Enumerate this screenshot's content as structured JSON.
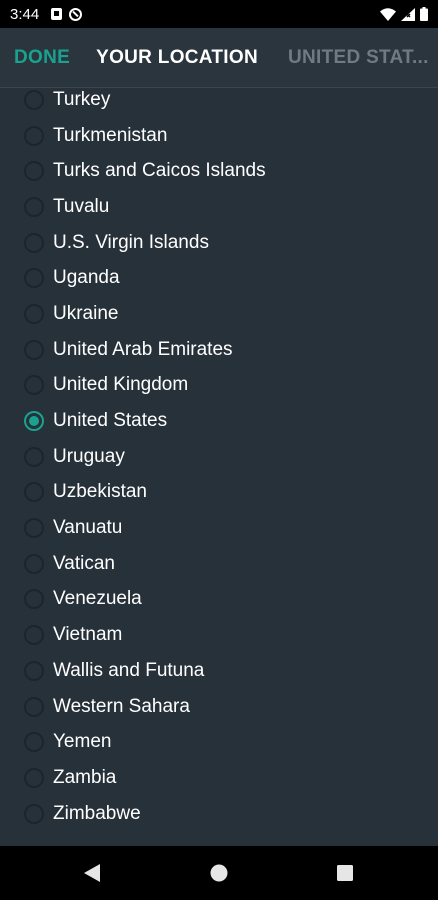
{
  "status_bar": {
    "time": "3:44",
    "left_icons": [
      "notification-square-icon",
      "sync-circle-icon"
    ],
    "right_icons": [
      "wifi-icon",
      "signal-icon",
      "battery-icon"
    ]
  },
  "header": {
    "done_label": "DONE",
    "title": "YOUR LOCATION",
    "selected_country": "UNITED STAT..."
  },
  "countries": [
    {
      "label": "Turkey",
      "selected": false
    },
    {
      "label": "Turkmenistan",
      "selected": false
    },
    {
      "label": "Turks and Caicos Islands",
      "selected": false
    },
    {
      "label": "Tuvalu",
      "selected": false
    },
    {
      "label": "U.S. Virgin Islands",
      "selected": false
    },
    {
      "label": "Uganda",
      "selected": false
    },
    {
      "label": "Ukraine",
      "selected": false
    },
    {
      "label": "United Arab Emirates",
      "selected": false
    },
    {
      "label": "United Kingdom",
      "selected": false
    },
    {
      "label": "United States",
      "selected": true
    },
    {
      "label": "Uruguay",
      "selected": false
    },
    {
      "label": "Uzbekistan",
      "selected": false
    },
    {
      "label": "Vanuatu",
      "selected": false
    },
    {
      "label": "Vatican",
      "selected": false
    },
    {
      "label": "Venezuela",
      "selected": false
    },
    {
      "label": "Vietnam",
      "selected": false
    },
    {
      "label": "Wallis and Futuna",
      "selected": false
    },
    {
      "label": "Western Sahara",
      "selected": false
    },
    {
      "label": "Yemen",
      "selected": false
    },
    {
      "label": "Zambia",
      "selected": false
    },
    {
      "label": "Zimbabwe",
      "selected": false
    }
  ],
  "colors": {
    "accent": "#1aa290",
    "header_bg": "#2b353d",
    "list_bg": "#27313a"
  },
  "nav_bar": {
    "icons": [
      "back-icon",
      "home-icon",
      "recents-icon"
    ]
  }
}
